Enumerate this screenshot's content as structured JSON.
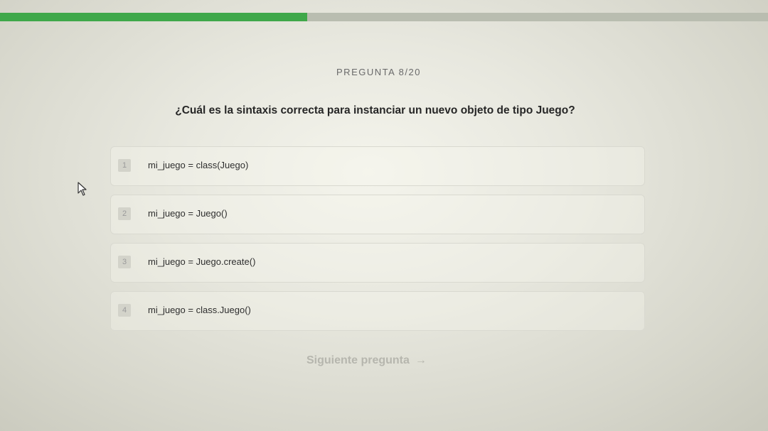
{
  "progress": {
    "fraction": 0.4
  },
  "quiz": {
    "counter": "PREGUNTA 8/20",
    "question": "¿Cuál es la sintaxis correcta para instanciar un nuevo objeto de tipo Juego?",
    "options": [
      {
        "number": "1",
        "label": "mi_juego = class(Juego)"
      },
      {
        "number": "2",
        "label": "mi_juego = Juego()"
      },
      {
        "number": "3",
        "label": "mi_juego = Juego.create()"
      },
      {
        "number": "4",
        "label": "mi_juego = class.Juego()"
      }
    ],
    "next_label": "Siguiente pregunta",
    "next_icon": "arrow-right-icon"
  },
  "colors": {
    "accent": "#3fa84a",
    "disabled_text": "#b6b6ae"
  }
}
